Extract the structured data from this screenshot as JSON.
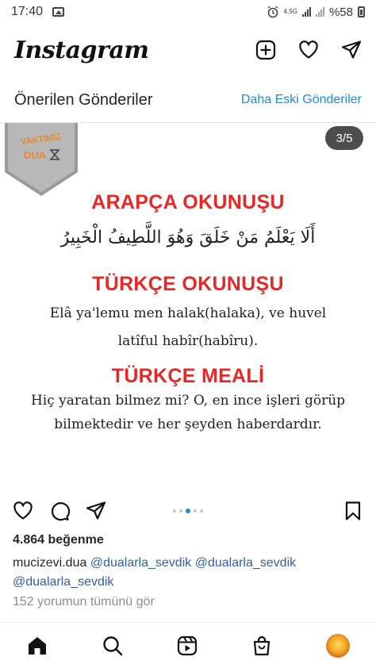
{
  "status_bar": {
    "time": "17:40",
    "network": "4.5G",
    "battery": "%58"
  },
  "app": {
    "logo": "Instagram"
  },
  "section": {
    "title": "Önerilen Gönderiler",
    "link": "Daha Eski Gönderiler"
  },
  "post": {
    "badge_text_top": "VAKTİMİZ",
    "badge_text_bottom": "DUA",
    "counter": "3/5",
    "heading_arabic": "ARAPÇA OKUNUŞU",
    "arabic_text": "أَلَا يَعْلَمُ مَنْ خَلَقَ وَهُوَ اللَّطِيفُ الْخَبِيرُ",
    "heading_turkish": "TÜRKÇE OKUNUŞU",
    "turkish_line1": "Elâ ya'lemu men halak(halaka), ve huvel",
    "turkish_line2": "latîful habîr(habîru).",
    "heading_meal": "TÜRKÇE MEALİ",
    "meal_line1": "Hiç yaratan bilmez mi? O, en ince işleri görüp",
    "meal_line2": "bilmektedir ve her şeyden haberdardır."
  },
  "carousel": {
    "total": 5,
    "active_index": 2
  },
  "likes": "4.864 beğenme",
  "caption": {
    "user": "mucizevi.dua",
    "tag1": "@dualarla_sevdik",
    "tag2": "@dualarla_sevdik",
    "tag3": "@dualarla_sevdik"
  },
  "comments_link": "152 yorumun tümünü gör",
  "colors": {
    "accent_red": "#e52828",
    "link_blue": "#1a8cd8",
    "tag_blue": "#2f5fa6"
  }
}
